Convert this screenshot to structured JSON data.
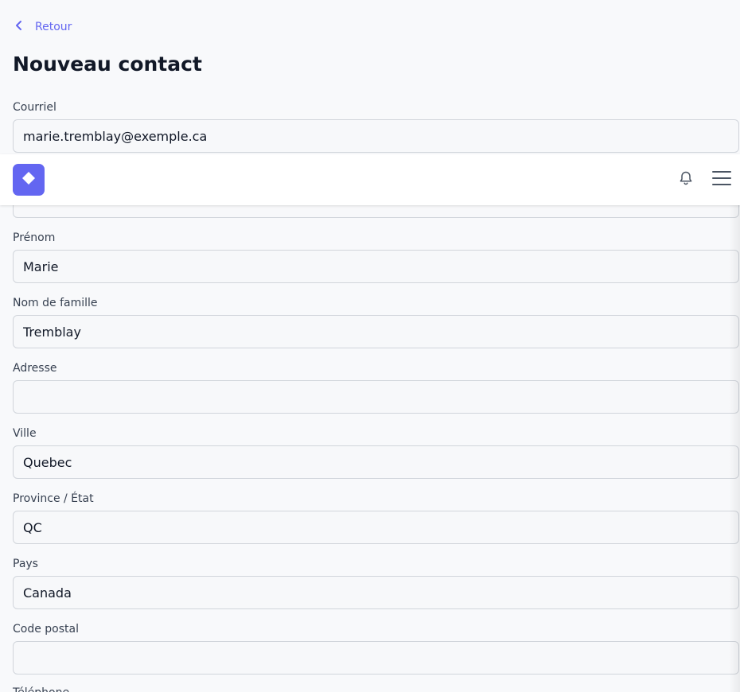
{
  "back": {
    "label": "Retour",
    "icon": "chevron-left-icon"
  },
  "page_title": "Nouveau contact",
  "topbar": {
    "logo_icon": "diamond-logo-icon",
    "notification_icon": "bell-icon",
    "menu_icon": "hamburger-menu-icon",
    "accent_color": "#6366f1"
  },
  "form": {
    "email": {
      "label": "Courriel",
      "value": "marie.tremblay@exemple.ca"
    },
    "hidden_field": {
      "value": ""
    },
    "first_name": {
      "label": "Prénom",
      "value": "Marie"
    },
    "last_name": {
      "label": "Nom de famille",
      "value": "Tremblay"
    },
    "address": {
      "label": "Adresse",
      "value": ""
    },
    "city": {
      "label": "Ville",
      "value": "Quebec"
    },
    "province": {
      "label": "Province / État",
      "value": "QC"
    },
    "country": {
      "label": "Pays",
      "value": "Canada"
    },
    "postal_code": {
      "label": "Code postal",
      "value": ""
    },
    "phone": {
      "label": "Téléphone"
    }
  }
}
